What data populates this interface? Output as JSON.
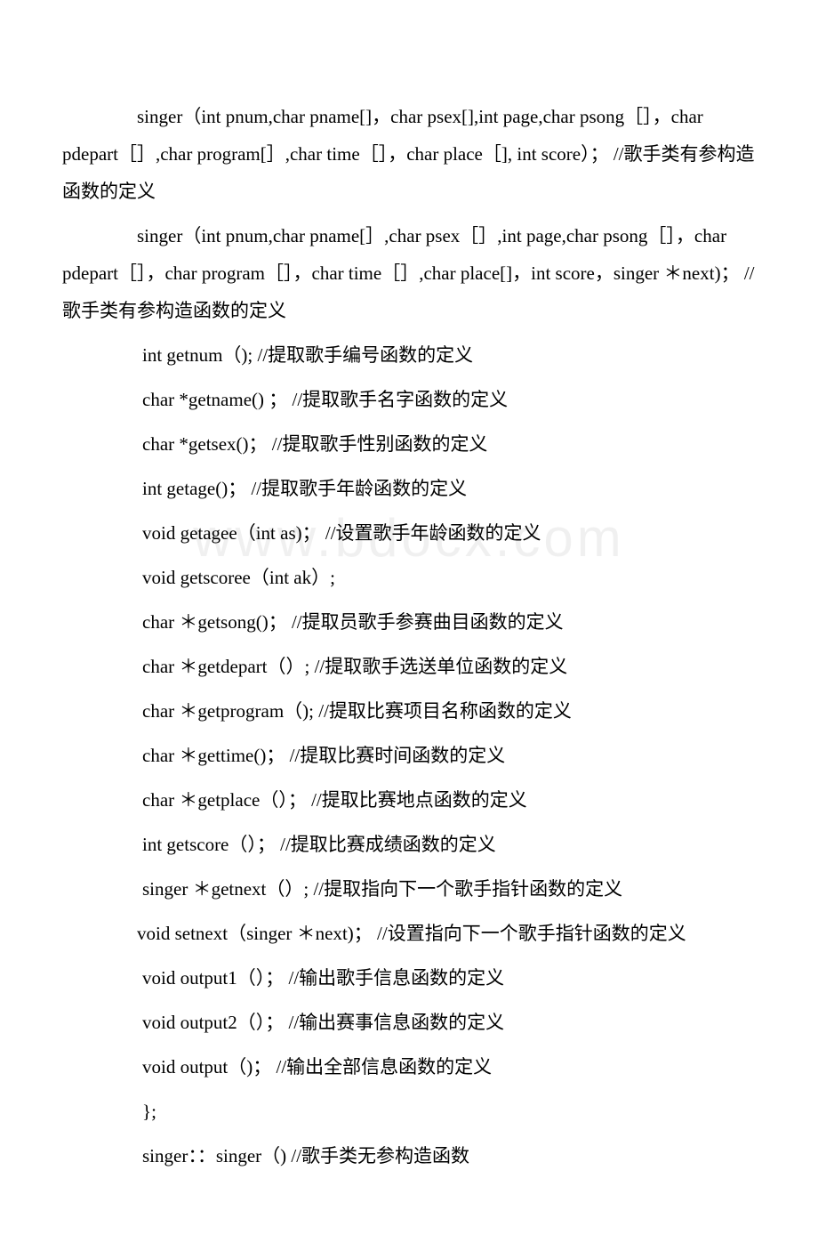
{
  "watermark": "www.bdocx.com",
  "lines": [
    {
      "indent": false,
      "text": "　　　　singer（int pnum,char pname[]，char psex[],int page,char psong［］，char pdepart［］,char program[］,char time［］，char place［],  int score）； //歌手类有参构造函数的定义"
    },
    {
      "indent": false,
      "text": "　　　　singer（int pnum,char pname[］,char psex［］,int page,char psong［］，char pdepart［］，char program［］，char time［］,char place[]，int score，singer ＊next)； //歌手类有参构造函数的定义"
    },
    {
      "indent": true,
      "text": "int getnum（); //提取歌手编号函数的定义"
    },
    {
      "indent": true,
      "text": "char *getname()  ； //提取歌手名字函数的定义"
    },
    {
      "indent": true,
      "text": "char *getsex()； //提取歌手性别函数的定义"
    },
    {
      "indent": true,
      "text": "int getage()； //提取歌手年龄函数的定义"
    },
    {
      "indent": true,
      "text": "void getagee（int as)； //设置歌手年龄函数的定义"
    },
    {
      "indent": true,
      "text": "void getscoree（int ak）;"
    },
    {
      "indent": true,
      "text": "char ＊getsong()； //提取员歌手参赛曲目函数的定义"
    },
    {
      "indent": true,
      "text": "char ＊getdepart（）;   //提取歌手选送单位函数的定义"
    },
    {
      "indent": true,
      "text": "char ＊getprogram（); //提取比赛项目名称函数的定义"
    },
    {
      "indent": true,
      "text": "char ＊gettime()； //提取比赛时间函数的定义"
    },
    {
      "indent": true,
      "text": "char ＊getplace（）； //提取比赛地点函数的定义"
    },
    {
      "indent": true,
      "text": "int getscore（）； //提取比赛成绩函数的定义"
    },
    {
      "indent": true,
      "text": "singer ＊getnext（）; //提取指向下一个歌手指针函数的定义"
    },
    {
      "indent": false,
      "text": "　　　　void setnext（singer ＊next)； //设置指向下一个歌手指针函数的定义"
    },
    {
      "indent": true,
      "text": "void output1（）； //输出歌手信息函数的定义"
    },
    {
      "indent": true,
      "text": "void output2（）； //输出赛事信息函数的定义"
    },
    {
      "indent": true,
      "text": "void output（)； //输出全部信息函数的定义"
    },
    {
      "indent": true,
      "text": "};"
    },
    {
      "indent": true,
      "text": "singer：：singer（) //歌手类无参构造函数"
    }
  ]
}
